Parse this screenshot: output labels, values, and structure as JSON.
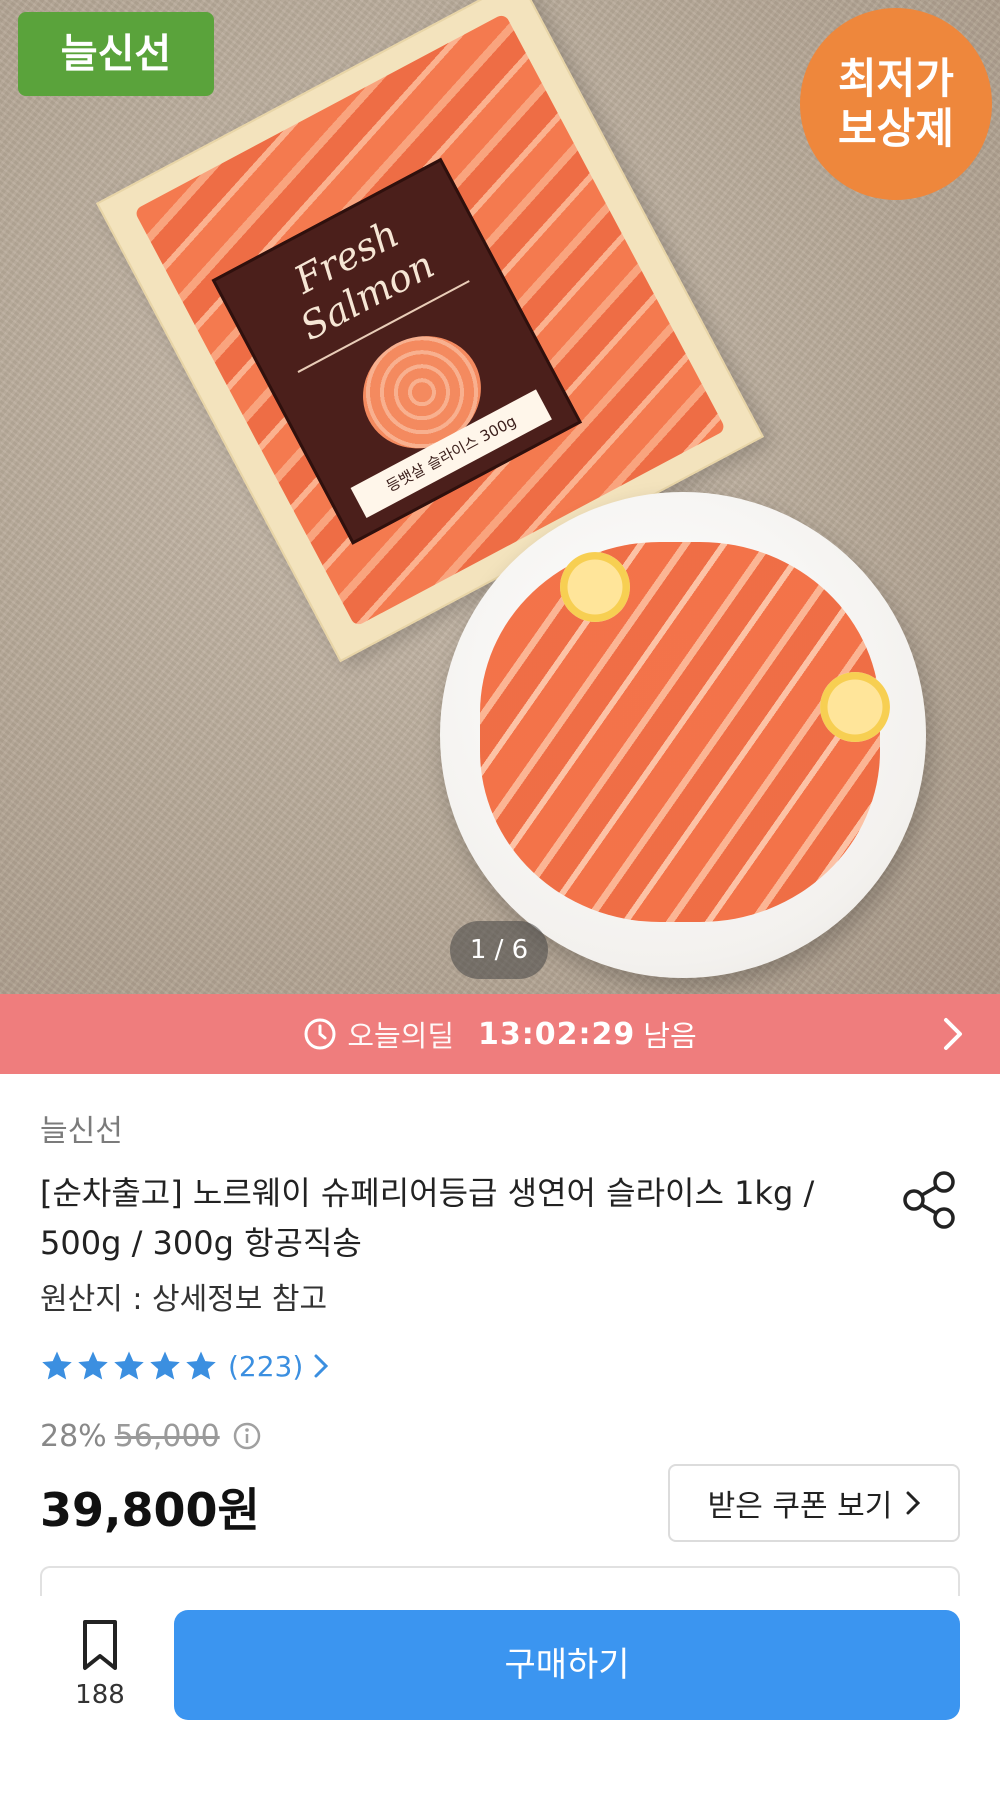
{
  "hero": {
    "badge_left": "늘신선",
    "badge_right_line1": "최저가",
    "badge_right_line2": "보상제",
    "pack_label_title": "Fresh Salmon",
    "pack_label_tag": "등뱃살 슬라이스 300g",
    "pager": "1 / 6"
  },
  "deal": {
    "label": "오늘의딜",
    "time": "13:02:29",
    "suffix": "남음"
  },
  "product": {
    "seller": "늘신선",
    "title": "[순차출고] 노르웨이 슈페리어등급 생연어 슬라이스 1kg / 500g / 300g 항공직송",
    "origin": "원산지 : 상세정보 참고",
    "rating_stars": 5,
    "review_count": "(223)",
    "discount_rate": "28%",
    "original_price": "56,000",
    "price": "39,800원",
    "coupon_button": "받은 쿠폰 보기"
  },
  "bottom": {
    "bookmark_count": "188",
    "buy_button": "구매하기"
  },
  "colors": {
    "deal_bar": "#ef7d7d",
    "buy_button": "#3b95f0",
    "star": "#3b8fe0",
    "fresh_badge": "#5aa33b",
    "price_badge": "#ee873c"
  }
}
